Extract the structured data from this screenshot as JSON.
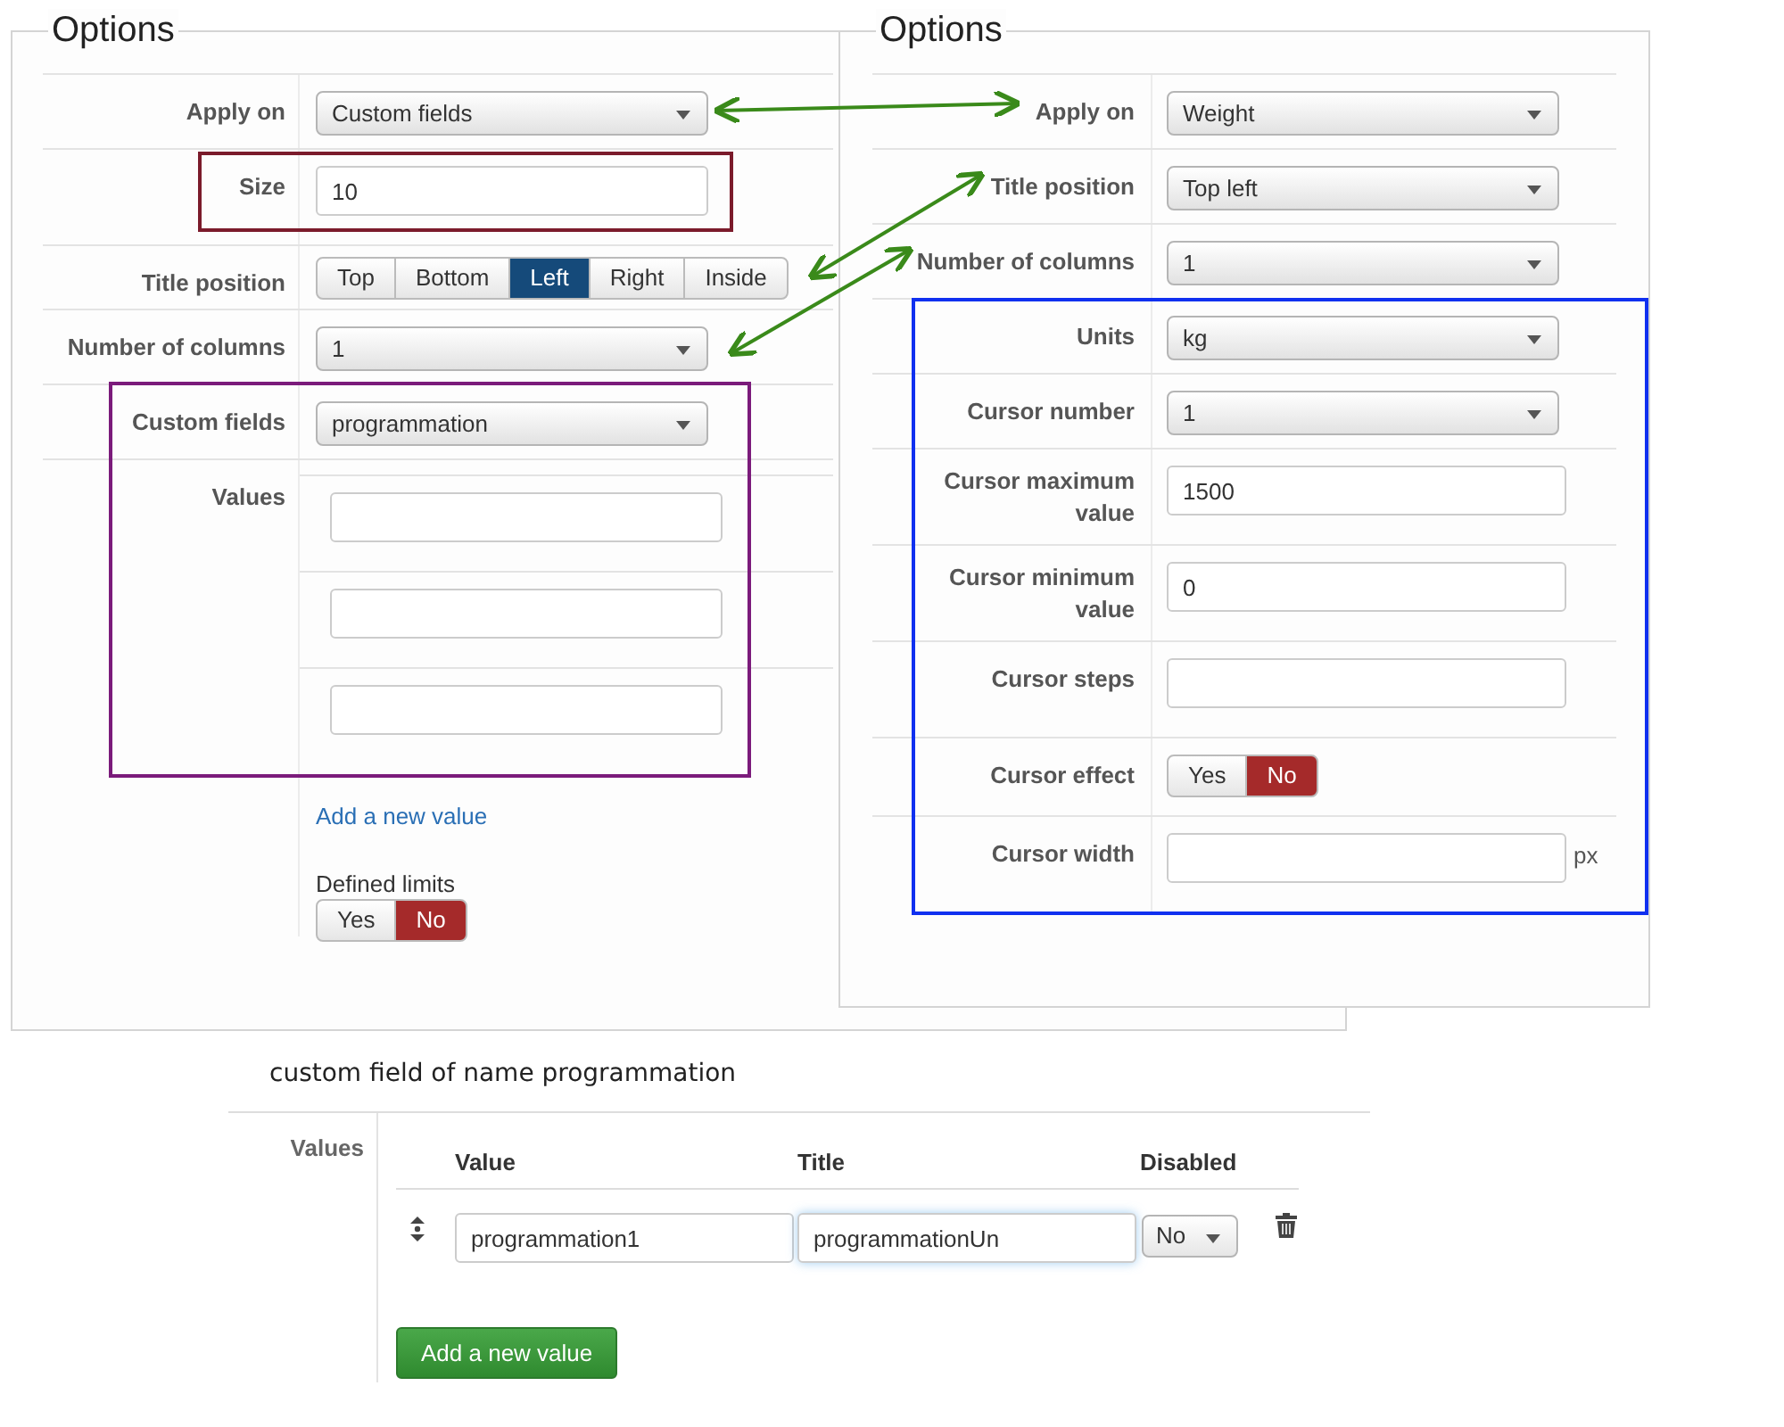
{
  "panels": [
    {
      "title": "Options",
      "rows": [
        {
          "kind": "select",
          "label": "Apply on",
          "value": "Custom fields"
        },
        {
          "kind": "input",
          "label": "Size",
          "value": "10"
        },
        {
          "kind": "segmented",
          "label": "Title position",
          "options": [
            {
              "label": "Top",
              "selected": false
            },
            {
              "label": "Bottom",
              "selected": false
            },
            {
              "label": "Left",
              "selected": true
            },
            {
              "label": "Right",
              "selected": false
            },
            {
              "label": "Inside",
              "selected": false
            }
          ]
        },
        {
          "kind": "select",
          "label": "Number of columns",
          "value": "1"
        },
        {
          "kind": "select",
          "label": "Custom fields",
          "value": "programmation"
        },
        {
          "kind": "values",
          "label": "Values",
          "inputs": [
            {
              "kind": "text"
            },
            {
              "kind": "text"
            },
            {
              "kind": "text"
            }
          ],
          "link": "Add a new value",
          "limits": {
            "label": "Defined limits",
            "options": [
              {
                "label": "Yes",
                "selected": false
              },
              {
                "label": "No",
                "selected": true
              }
            ]
          }
        }
      ]
    },
    {
      "title": "Options",
      "rows": [
        {
          "kind": "select",
          "label": "Apply on",
          "value": "Weight"
        },
        {
          "kind": "select",
          "label": "Title position",
          "value": "Top left"
        },
        {
          "kind": "select",
          "label": "Number of columns",
          "value": "1"
        },
        {
          "kind": "select",
          "label": "Units",
          "value": "kg"
        },
        {
          "kind": "select",
          "label": "Cursor number",
          "value": "1"
        },
        {
          "kind": "input",
          "label": "Cursor maximum value",
          "value": "1500"
        },
        {
          "kind": "input",
          "label": "Cursor minimum value",
          "value": "0"
        },
        {
          "kind": "input",
          "label": "Cursor steps"
        },
        {
          "kind": "toggle",
          "label": "Cursor effect",
          "options": [
            {
              "label": "Yes",
              "selected": false
            },
            {
              "label": "No",
              "selected": true
            }
          ]
        },
        {
          "kind": "input",
          "label": "Cursor width",
          "suffix": "px"
        }
      ]
    }
  ],
  "highlights": [
    {
      "color": "#7b1b2b"
    },
    {
      "color": "#7b1b7b"
    },
    {
      "color": "#1030f0"
    }
  ],
  "custom_field": {
    "caption": "custom field of name programmation",
    "label": "Values",
    "columns": [
      "Value",
      "Title",
      "Disabled"
    ],
    "rows": [
      {
        "value": "programmation1",
        "title": "programmationUn",
        "title_focused": true,
        "disabled": "No"
      }
    ],
    "button": "Add a new value"
  }
}
